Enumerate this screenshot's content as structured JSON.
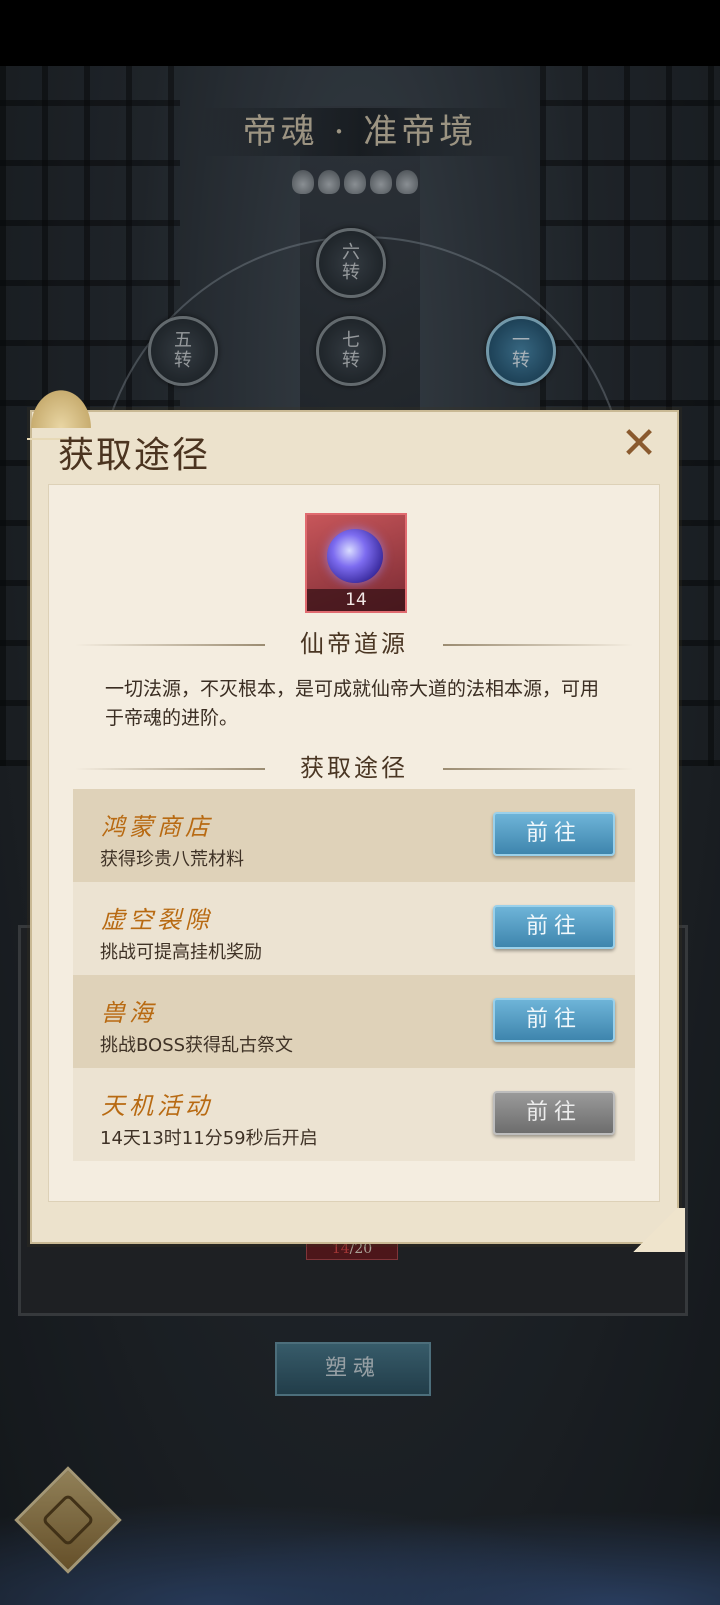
{
  "realm": {
    "title": "帝魂 · 准帝境",
    "nodes": [
      {
        "label_top": "六",
        "label_bottom": "转",
        "active": false
      },
      {
        "label_top": "五",
        "label_bottom": "转",
        "active": false
      },
      {
        "label_top": "七",
        "label_bottom": "转",
        "active": false
      },
      {
        "label_top": "一",
        "label_bottom": "转",
        "active": true
      }
    ]
  },
  "background": {
    "count_current": "14",
    "count_total": "/20",
    "shape_button": "塑魂"
  },
  "popup": {
    "title": "获取途径",
    "close_icon": "close-x-icon",
    "item": {
      "count": "14",
      "name": "仙帝道源",
      "description": "一切法源，不灭根本，是可成就仙帝大道的法相本源，可用于帝魂的进阶。"
    },
    "routes_heading": "获取途径",
    "routes": [
      {
        "name": "鸿蒙商店",
        "desc": "获得珍贵八荒材料",
        "button": "前往",
        "enabled": true
      },
      {
        "name": "虚空裂隙",
        "desc": "挑战可提高挂机奖励",
        "button": "前往",
        "enabled": true
      },
      {
        "name": "兽海",
        "desc": "挑战BOSS获得乱古祭文",
        "button": "前往",
        "enabled": true
      },
      {
        "name": "天机活动",
        "desc": "14天13时11分59秒后开启",
        "button": "前往",
        "enabled": false
      }
    ]
  }
}
